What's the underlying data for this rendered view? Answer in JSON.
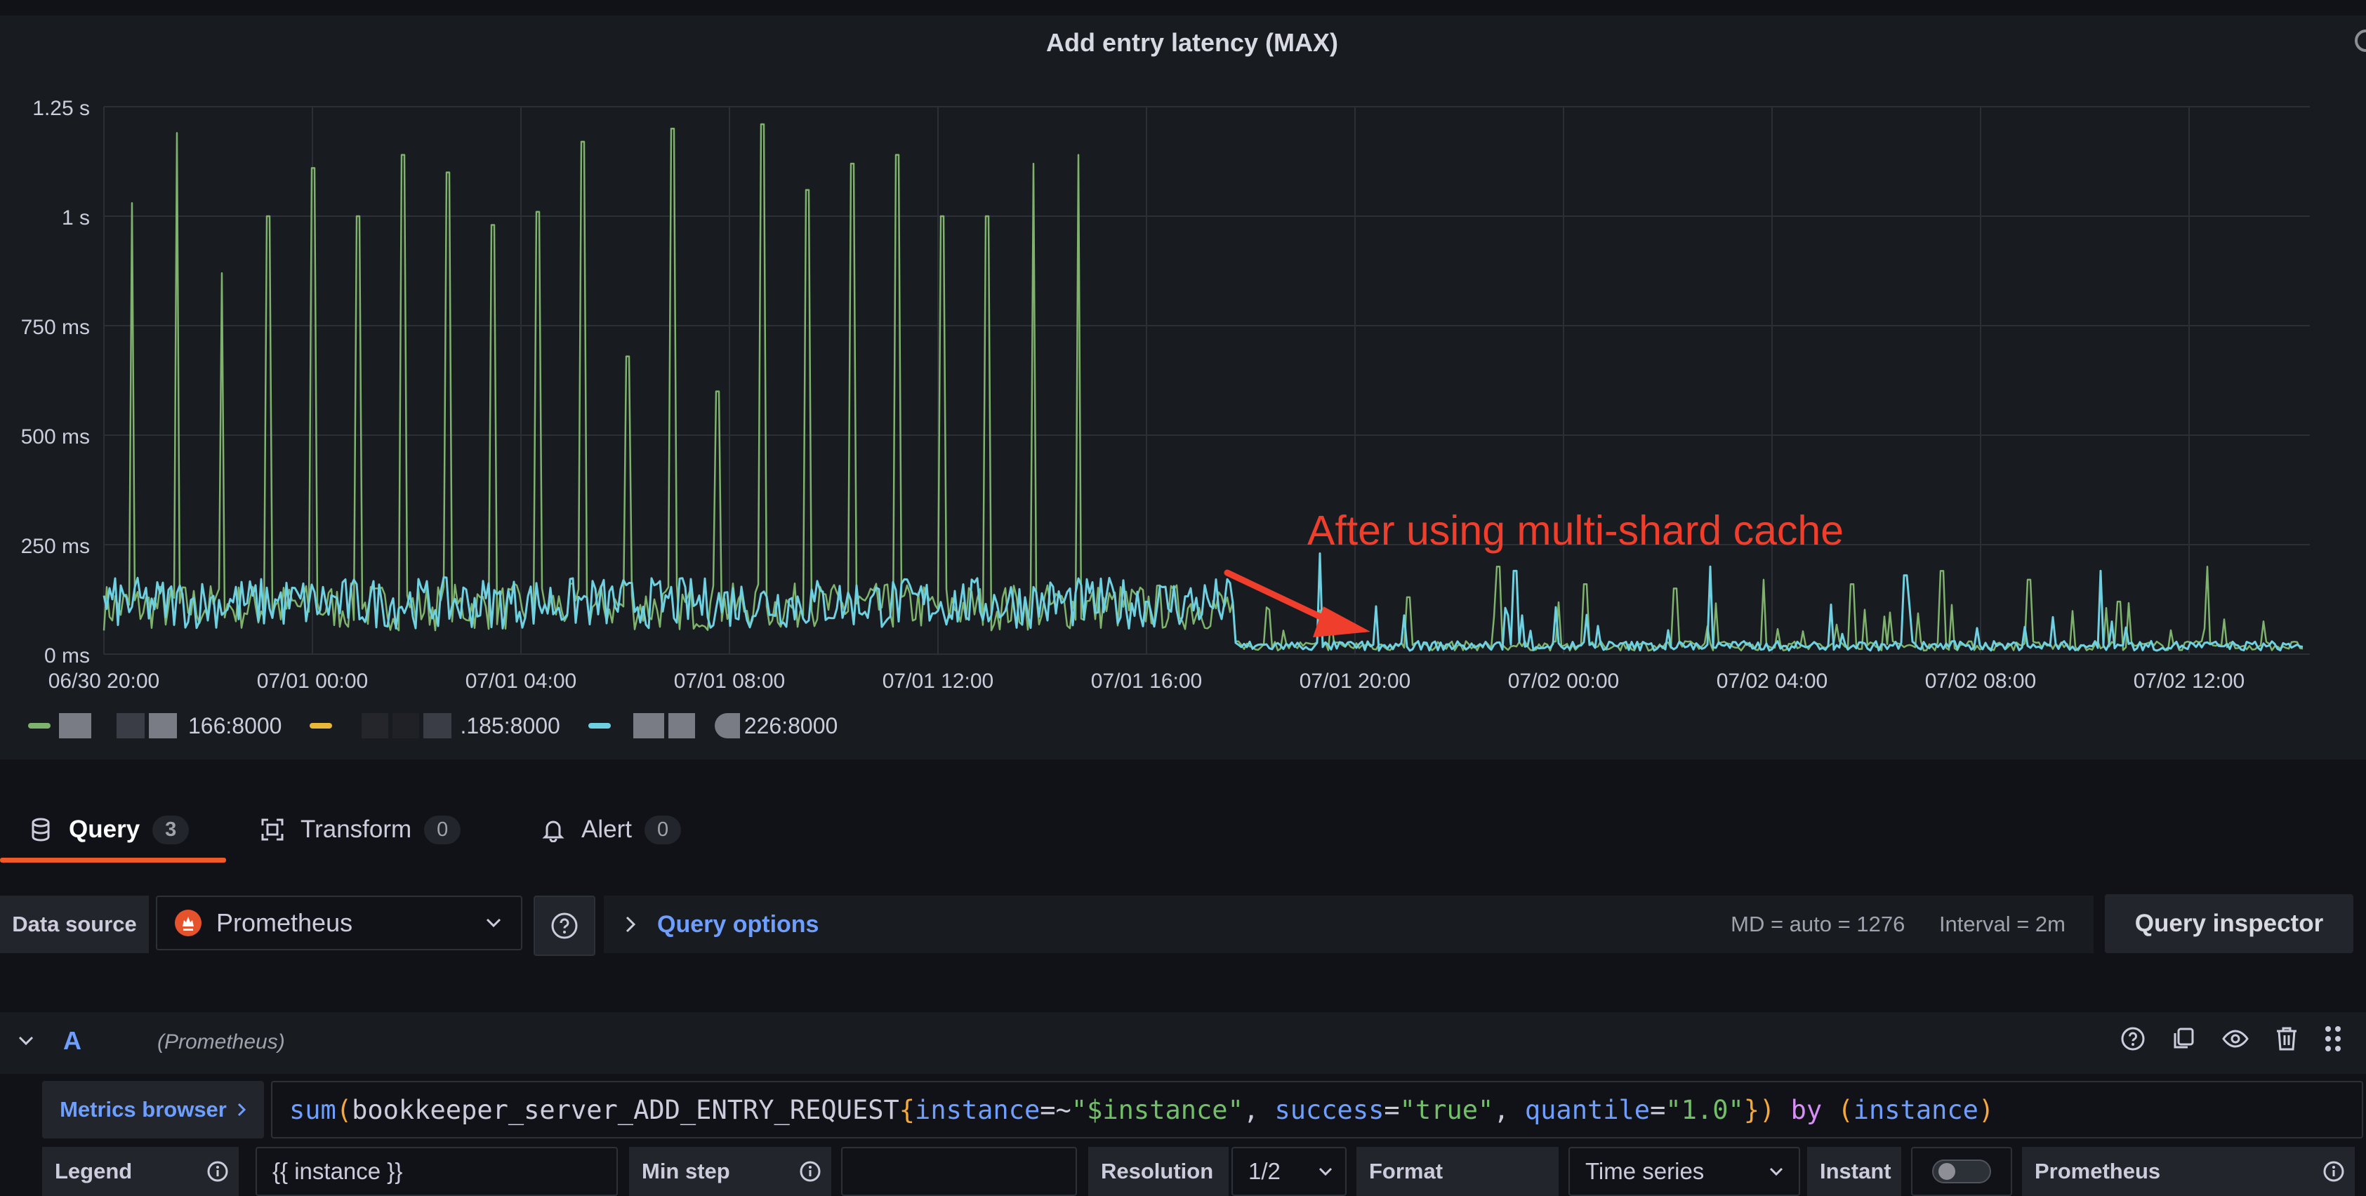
{
  "panel": {
    "title": "Add entry latency (MAX)",
    "annotation": "After using multi-shard cache"
  },
  "chart_data": {
    "type": "line",
    "title": "Add entry latency (MAX)",
    "y_ticks": [
      "0 ms",
      "250 ms",
      "500 ms",
      "750 ms",
      "1 s",
      "1.25 s"
    ],
    "x_ticks": [
      "06/30 20:00",
      "07/01 00:00",
      "07/01 04:00",
      "07/01 08:00",
      "07/01 12:00",
      "07/01 16:00",
      "07/01 20:00",
      "07/02 00:00",
      "07/02 04:00",
      "07/02 08:00",
      "07/02 12:00"
    ],
    "ylim_ms": [
      0,
      1250
    ],
    "grid": true,
    "legend_placement": "bottom-left",
    "series": [
      {
        "name": "166:8000",
        "color": "#7eb26d",
        "note_values_ms": {
          "baseline_before": 120,
          "spikes_before": [
            1030,
            1190,
            870,
            1000,
            1110,
            1000,
            1140,
            1100,
            980,
            1010,
            1170,
            680,
            1200,
            600,
            1210,
            1060,
            1120,
            1140,
            1000,
            1000,
            1120,
            1140
          ],
          "baseline_after": 10,
          "spikes_after": [
            100,
            130,
            200,
            160,
            150,
            170,
            160,
            190,
            170,
            120,
            200
          ]
        }
      },
      {
        "name": ".185:8000",
        "color": "#eab839"
      },
      {
        "name": "226:8000",
        "color": "#6ed0e0",
        "note_values_ms": {
          "baseline_before": 130,
          "baseline_after": 10,
          "spikes_after": [
            230,
            190,
            200,
            180,
            190
          ]
        }
      }
    ]
  },
  "legend": {
    "items": [
      {
        "label": "166:8000",
        "color": "#7eb26d"
      },
      {
        "label": ".185:8000",
        "color": "#eab839"
      },
      {
        "label": "226:8000",
        "color": "#6ed0e0"
      }
    ]
  },
  "tabs": [
    {
      "label": "Query",
      "count": "3"
    },
    {
      "label": "Transform",
      "count": "0"
    },
    {
      "label": "Alert",
      "count": "0"
    }
  ],
  "datasource": {
    "label": "Data source",
    "value": "Prometheus"
  },
  "query_options": {
    "title": "Query options",
    "md": "MD = auto = 1276",
    "interval": "Interval = 2m"
  },
  "query_inspector": "Query inspector",
  "query_a": {
    "letter": "A",
    "datasource": "(Prometheus)",
    "metrics_browser": "Metrics browser",
    "expr": {
      "fn": "sum",
      "metric": "bookkeeper_server_ADD_ENTRY_REQUEST",
      "l1": "instance",
      "op1": "=~",
      "v1": "\"$instance\"",
      "l2": "success",
      "op2": "=",
      "v2": "\"true\"",
      "l3": "quantile",
      "op3": "=",
      "v3": "\"1.0\"",
      "by": "by",
      "by_label": "instance"
    },
    "legend_label": "Legend",
    "legend_value": "{{ instance }}",
    "min_step_label": "Min step",
    "min_step_value": "",
    "resolution_label": "Resolution",
    "resolution_value": "1/2",
    "format_label": "Format",
    "format_value": "Time series",
    "instant_label": "Instant",
    "exemplar_label": "Prometheus"
  }
}
